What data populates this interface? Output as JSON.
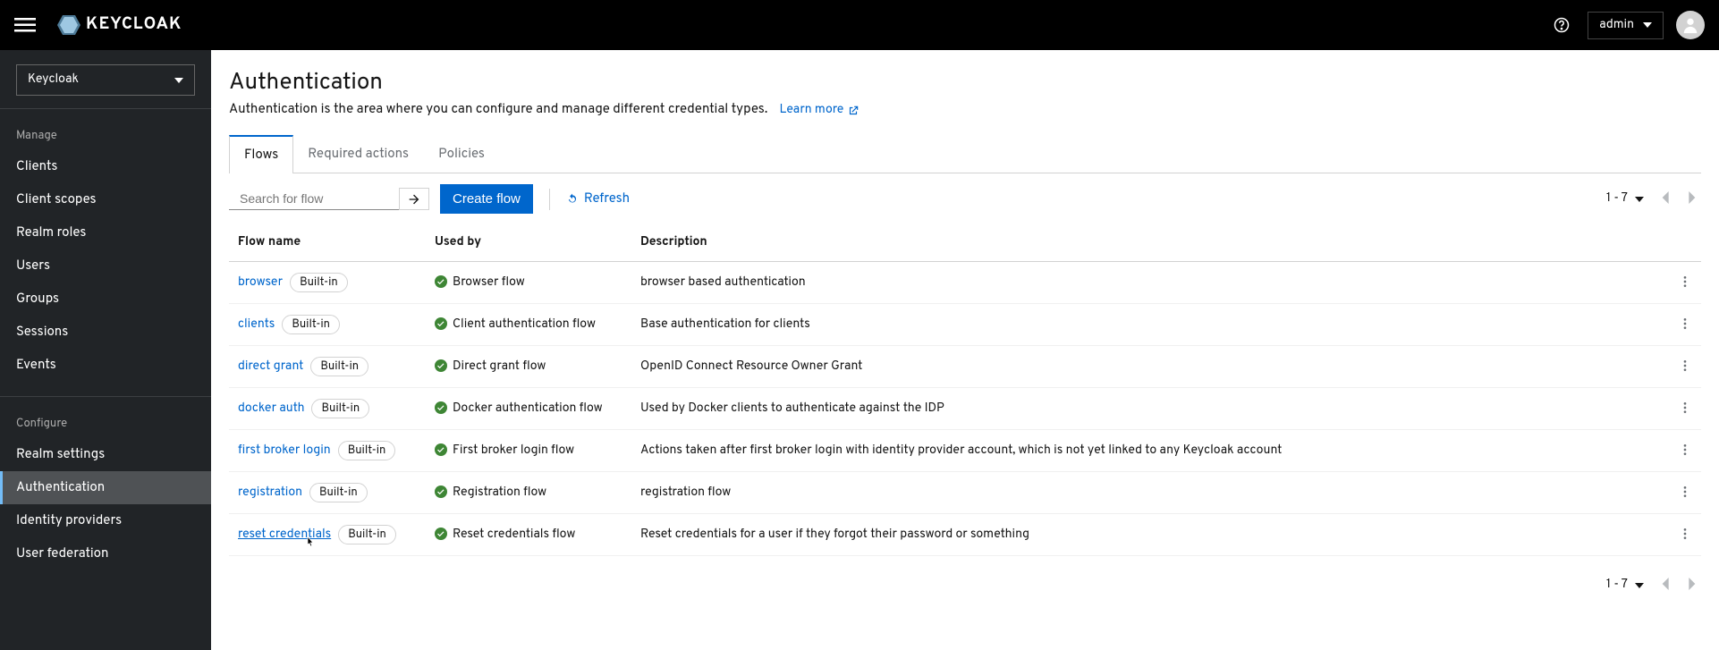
{
  "header": {
    "brand": "KEYCLOAK",
    "user_label": "admin"
  },
  "sidebar": {
    "realm_selected": "Keycloak",
    "sections": {
      "manage": {
        "title": "Manage",
        "items": [
          "Clients",
          "Client scopes",
          "Realm roles",
          "Users",
          "Groups",
          "Sessions",
          "Events"
        ]
      },
      "configure": {
        "title": "Configure",
        "items": [
          "Realm settings",
          "Authentication",
          "Identity providers",
          "User federation"
        ]
      }
    },
    "active_item": "Authentication"
  },
  "page": {
    "title": "Authentication",
    "description": "Authentication is the area where you can configure and manage different credential types.",
    "learn_more": "Learn more"
  },
  "tabs": {
    "items": [
      "Flows",
      "Required actions",
      "Policies"
    ],
    "active": "Flows"
  },
  "toolbar": {
    "search_placeholder": "Search for flow",
    "create_label": "Create flow",
    "refresh_label": "Refresh",
    "pager_label": "1 - 7"
  },
  "table": {
    "columns": {
      "flow_name": "Flow name",
      "used_by": "Used by",
      "description": "Description"
    },
    "badge_builtin": "Built-in",
    "rows": [
      {
        "name": "browser",
        "used_by": "Browser flow",
        "desc": "browser based authentication"
      },
      {
        "name": "clients",
        "used_by": "Client authentication flow",
        "desc": "Base authentication for clients"
      },
      {
        "name": "direct grant",
        "used_by": "Direct grant flow",
        "desc": "OpenID Connect Resource Owner Grant"
      },
      {
        "name": "docker auth",
        "used_by": "Docker authentication flow",
        "desc": "Used by Docker clients to authenticate against the IDP"
      },
      {
        "name": "first broker login",
        "used_by": "First broker login flow",
        "desc": "Actions taken after first broker login with identity provider account, which is not yet linked to any Keycloak account"
      },
      {
        "name": "registration",
        "used_by": "Registration flow",
        "desc": "registration flow"
      },
      {
        "name": "reset credentials",
        "used_by": "Reset credentials flow",
        "desc": "Reset credentials for a user if they forgot their password or something"
      }
    ],
    "hovered_row": 6
  }
}
